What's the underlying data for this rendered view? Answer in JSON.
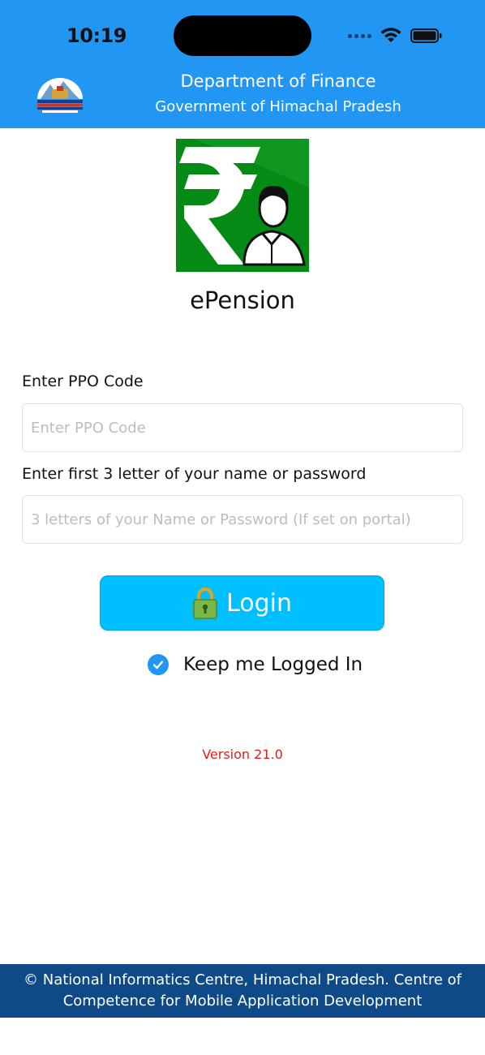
{
  "status_bar": {
    "time": "10:19"
  },
  "header": {
    "title": "Department of Finance",
    "subtitle": "Government of Himachal Pradesh"
  },
  "app": {
    "name": "ePension"
  },
  "form": {
    "ppo_label": "Enter PPO Code",
    "ppo_placeholder": "Enter PPO Code",
    "ppo_value": "",
    "name_label": "Enter first 3 letter of your name or password",
    "name_placeholder": "3 letters of your Name or Password (If set on portal)",
    "name_value": "",
    "login_label": "Login",
    "keep_logged_in_label": "Keep me Logged In",
    "keep_logged_in_checked": true
  },
  "version": "Version 21.0",
  "footer": {
    "text": "© National Informatics Centre, Himachal Pradesh. Centre of Competence for Mobile Application Development"
  },
  "colors": {
    "header_bg": "#2196f3",
    "logo_green": "#068a16",
    "login_button": "#00bfff",
    "checkbox": "#2196f3",
    "version_text": "#e0201a",
    "footer_bg": "#0d4a87"
  }
}
